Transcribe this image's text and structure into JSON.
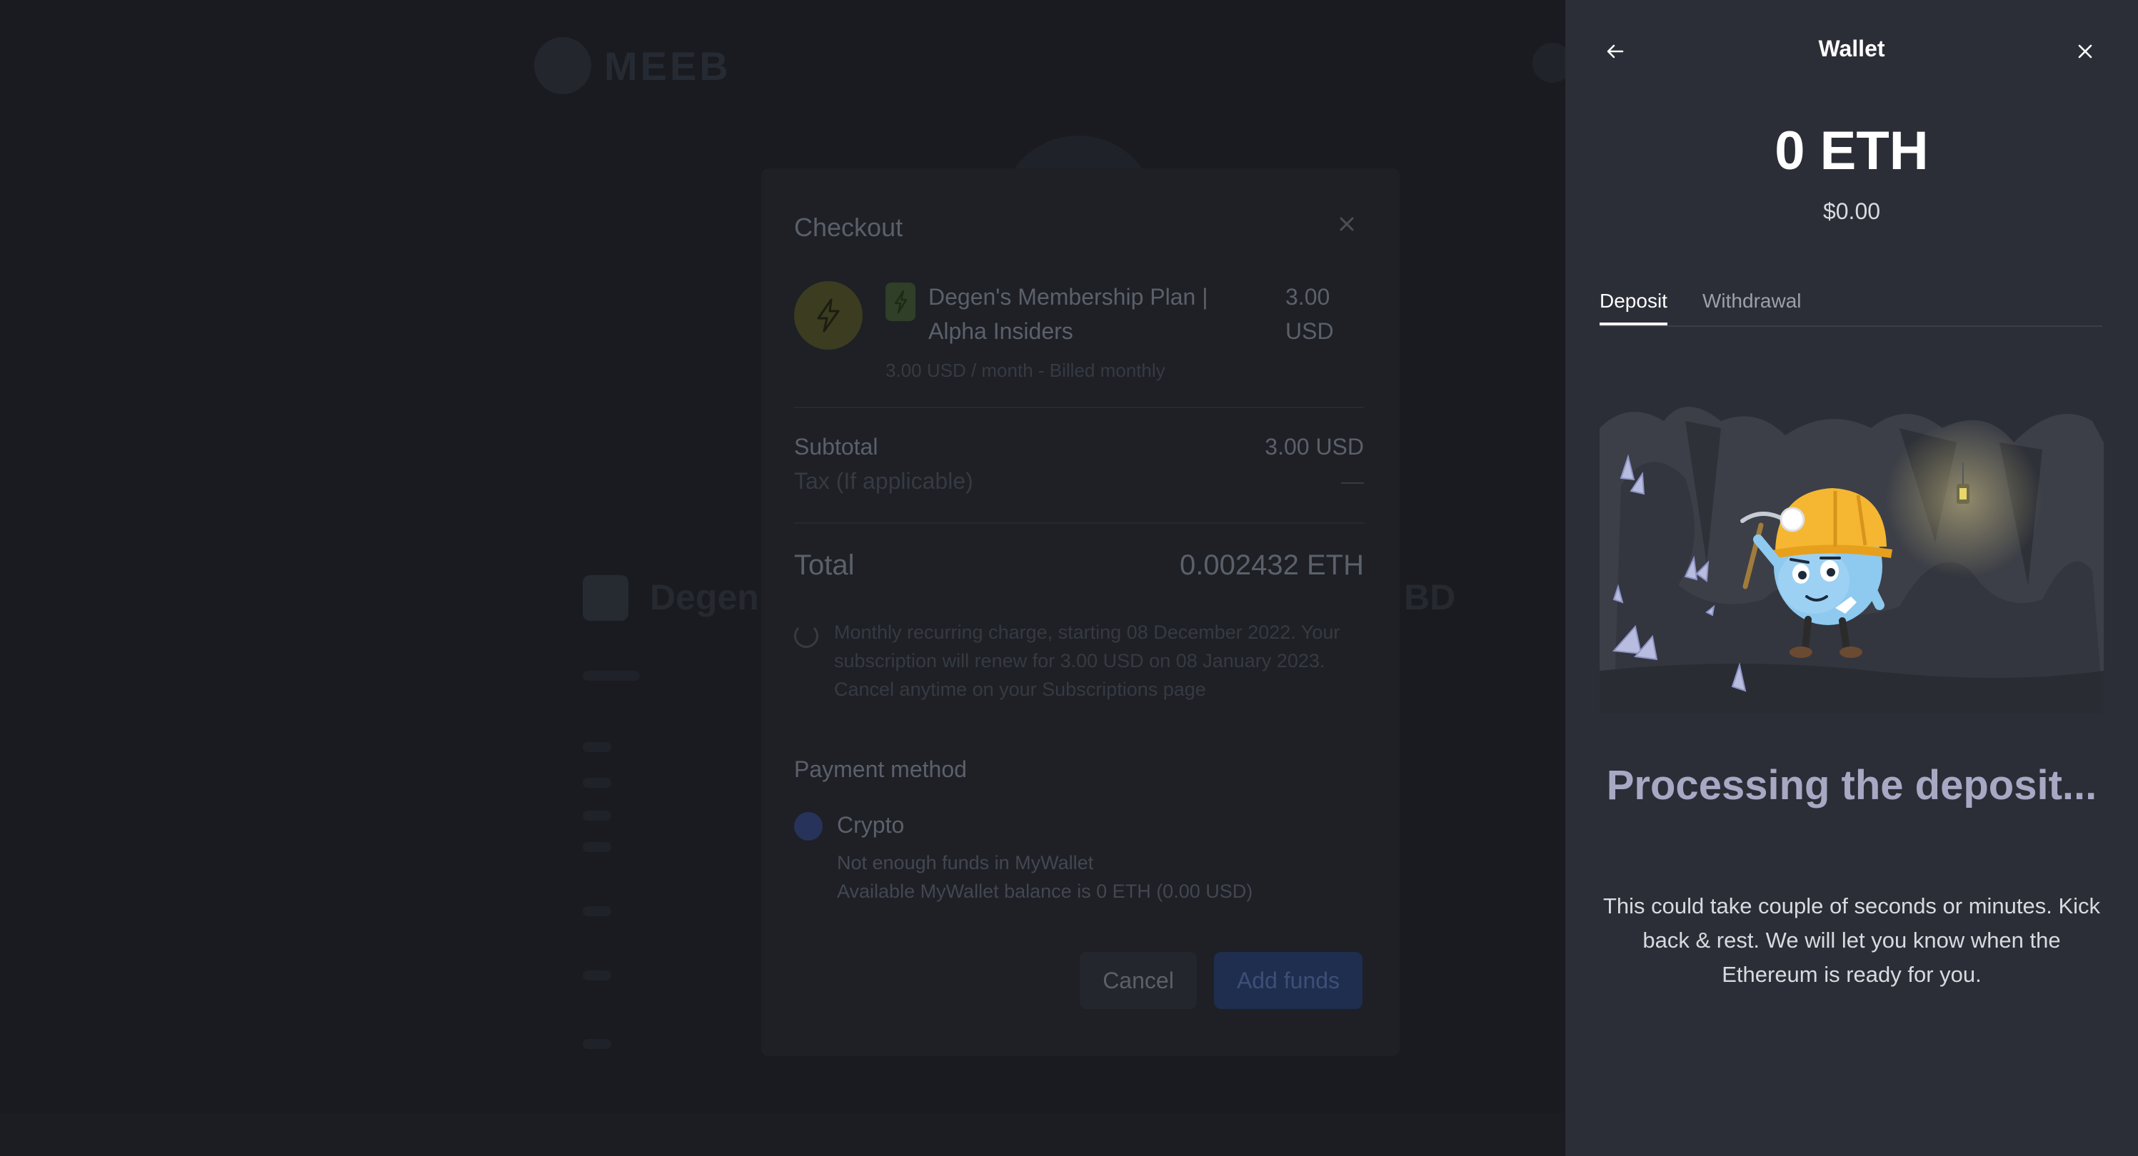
{
  "background": {
    "logo_text": "MEEB",
    "title_left": "Degen",
    "title_right": "BD"
  },
  "checkout": {
    "title": "Checkout",
    "plan_name": "Degen's Membership Plan | Alpha Insiders",
    "plan_price": "3.00 USD",
    "plan_billing": "3.00 USD / month - Billed monthly",
    "subtotal_label": "Subtotal",
    "subtotal_value": "3.00 USD",
    "tax_label": "Tax (If applicable)",
    "tax_value": "—",
    "total_label": "Total",
    "total_value": "0.002432 ETH",
    "recurring_text": "Monthly recurring charge, starting 08 December 2022. Your subscription will renew for 3.00 USD on 08 January 2023. Cancel anytime on your Subscriptions page",
    "payment_method_label": "Payment method",
    "crypto_label": "Crypto",
    "funds_warning": "Not enough funds in MyWallet",
    "funds_balance": "Available MyWallet balance is 0 ETH (0.00 USD)",
    "cancel_label": "Cancel",
    "add_funds_label": "Add funds"
  },
  "wallet": {
    "title": "Wallet",
    "back_icon": "arrow-left-icon",
    "close_icon": "close-icon",
    "balance": "0 ETH",
    "balance_usd": "$0.00",
    "tabs": [
      {
        "label": "Deposit",
        "active": true
      },
      {
        "label": "Withdrawal",
        "active": false
      }
    ],
    "heading": "Processing the deposit...",
    "body": "This could take couple of seconds or minutes. Kick back & rest. We will let you know when the Ethereum is ready for you."
  },
  "colors": {
    "panel_bg": "#2b2e36",
    "page_bg": "#191b21",
    "heading_color": "#a7a9c4",
    "miner_helmet": "#f5b731",
    "miner_body": "#8ec9ef"
  }
}
